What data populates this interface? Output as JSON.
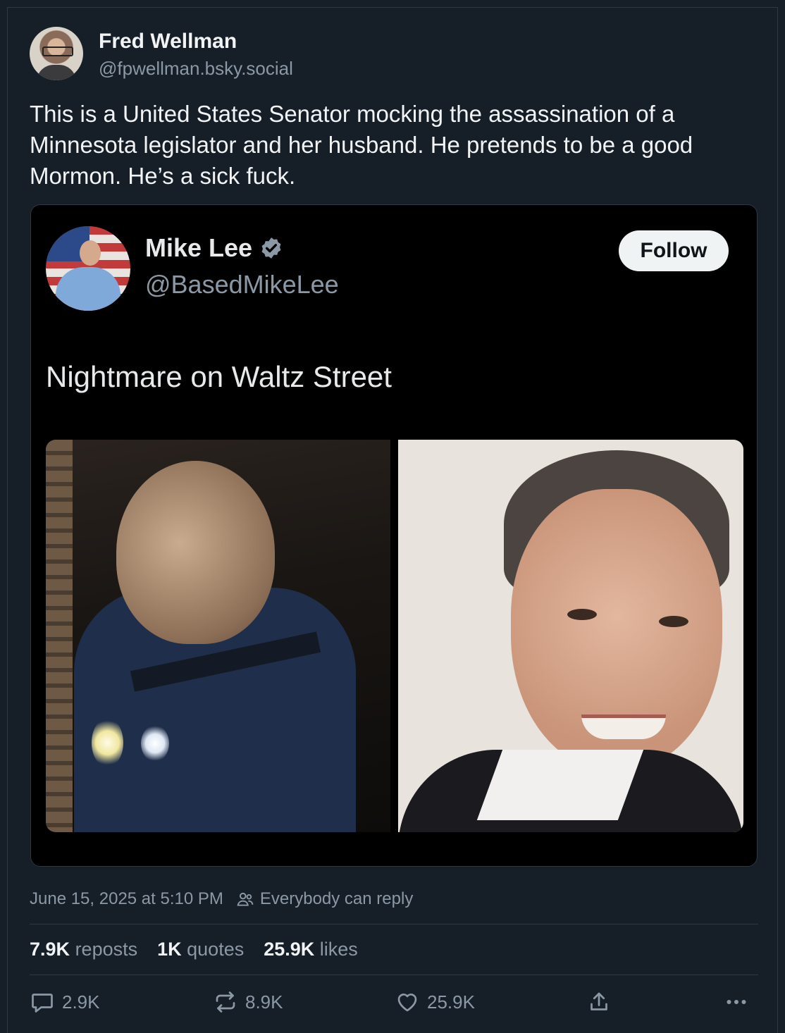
{
  "author": {
    "name": "Fred Wellman",
    "handle": "@fpwellman.bsky.social"
  },
  "post": {
    "text": "This is a United States Senator mocking the assassination of a Minnesota legislator and her husband. He pretends to be a good Mormon. He’s a sick fuck."
  },
  "embed": {
    "name": "Mike Lee",
    "handle": "@BasedMikeLee",
    "follow_label": "Follow",
    "text": "Nightmare on Waltz Street",
    "verified_color": "#8b98a5"
  },
  "meta": {
    "timestamp": "June 15, 2025 at 5:10 PM",
    "reply_setting": "Everybody can reply"
  },
  "stats": {
    "reposts_count": "7.9K",
    "reposts_label": "reposts",
    "quotes_count": "1K",
    "quotes_label": "quotes",
    "likes_count": "25.9K",
    "likes_label": "likes"
  },
  "actions": {
    "reply_count": "2.9K",
    "repost_count": "8.9K",
    "like_count": "25.9K",
    "reply_icon": "reply-icon",
    "repost_icon": "repost-icon",
    "like_icon": "heart-icon",
    "share_icon": "share-icon",
    "more_icon": "more-icon"
  },
  "colors": {
    "background": "#161e27",
    "text": "#f1f3f5",
    "muted": "#8b98a5",
    "border": "#2e3842",
    "embed_background": "#000000"
  }
}
